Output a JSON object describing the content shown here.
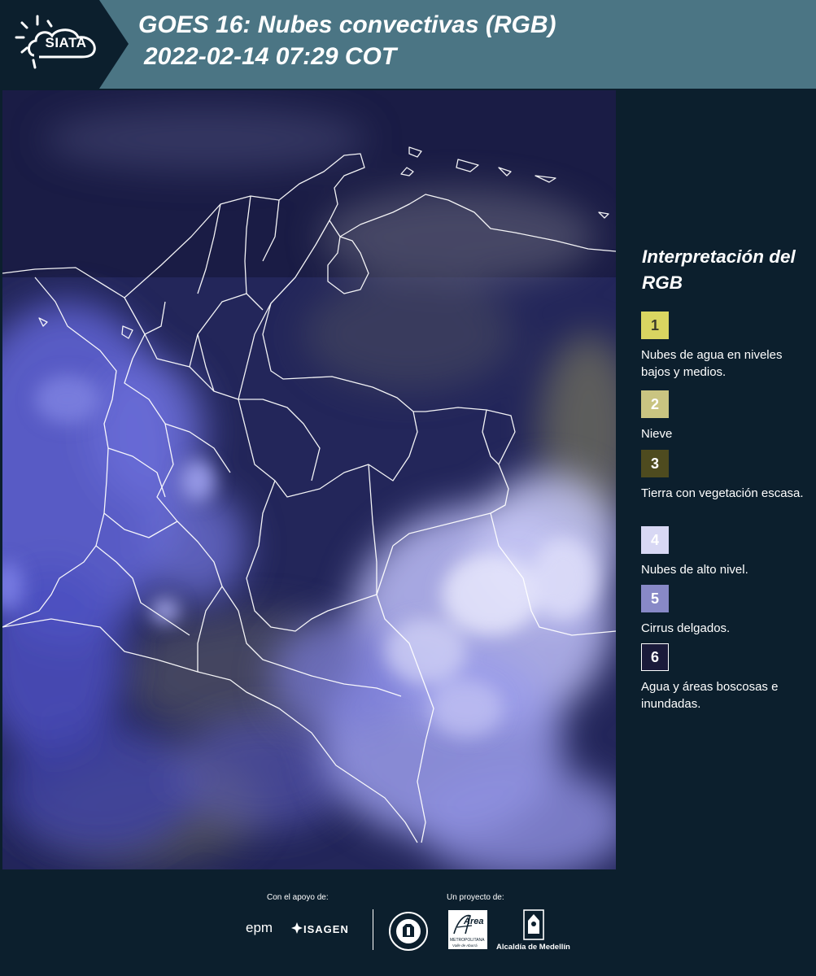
{
  "header": {
    "logo_text": "SIATA",
    "title_line1": "GOES 16: Nubes convectivas (RGB)",
    "title_line2": "2022-02-14 07:29 COT",
    "colors": {
      "bar": "#4b7584",
      "logo_bg": "#0c1f2d"
    }
  },
  "legend": {
    "title": "Interpretación del RGB",
    "items": [
      {
        "number": "1",
        "label": "Nubes de agua en niveles bajos y medios.",
        "color": "#d9d561",
        "text_color": "#3a3a2a"
      },
      {
        "number": "2",
        "label": "Nieve",
        "color": "#c9c481",
        "text_color": "#ffffff"
      },
      {
        "number": "3",
        "label": "Tierra con vegetación escasa.",
        "color": "#4e4b1f",
        "text_color": "#ffffff"
      },
      {
        "number": "4",
        "label": "Nubes de alto nivel.",
        "color": "#d8d8f4",
        "text_color": "#ffffff"
      },
      {
        "number": "5",
        "label": "Cirrus delgados.",
        "color": "#8889c7",
        "text_color": "#ffffff"
      },
      {
        "number": "6",
        "label": "Agua y áreas boscosas e inundadas.",
        "color": "#1a1a3a",
        "text_color": "#ffffff"
      }
    ]
  },
  "footer": {
    "support_label": "Con el apoyo de:",
    "project_label": "Un proyecto de:",
    "sponsors": [
      "epm",
      "ISAGEN"
    ],
    "partners": [
      "Área Metropolitana Valle de Aburrá",
      "Alcaldía de Medellín"
    ],
    "area_logo_text": "Área",
    "area_logo_subtext": "METROPOLITANA",
    "area_logo_subtext2": "Valle de Aburrá",
    "alcaldia_text": "Alcaldía de Medellín"
  }
}
